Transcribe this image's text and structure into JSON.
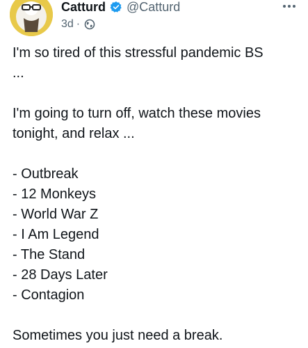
{
  "author": {
    "display_name": "Catturd",
    "handle": "@Catturd",
    "verified": true,
    "verified_color": "#1d9bf0",
    "avatar_icon": "cat-avatar"
  },
  "meta": {
    "time": "3d",
    "separator": "·",
    "visibility_icon": "globe-icon"
  },
  "tweet": {
    "line1a": "I'm so tired of this stressful pandemic BS",
    "line1b": "...",
    "line2a": "I'm going to turn off, watch these movies",
    "line2b": "tonight, and relax ...",
    "movies": [
      "- Outbreak",
      "- 12 Monkeys",
      "- World War Z",
      "- I Am Legend",
      "- The Stand",
      "- 28 Days Later",
      "- Contagion"
    ],
    "closing": "Sometimes you just need a break."
  },
  "colors": {
    "text": "#0f1419",
    "secondary": "#536471"
  }
}
